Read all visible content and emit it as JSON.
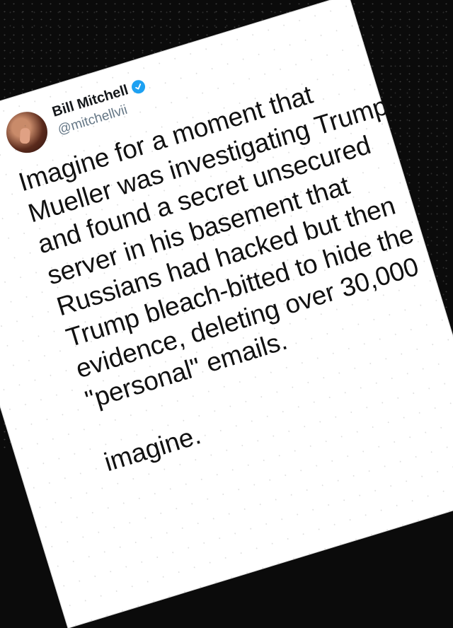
{
  "tweet": {
    "display_name": "Bill Mitchell",
    "handle": "@mitchellvii",
    "verified": true,
    "icons": {
      "avatar": "profile-photo",
      "badge": "verified-badge-icon"
    },
    "colors": {
      "verified": "#1da1f2",
      "handle": "#657786",
      "text": "#111111"
    },
    "lines": [
      "Imagine for a moment that",
      "Mueller was investigating Trump",
      "and found a secret unsecured",
      "server in his basement that",
      "Russians had hacked but then",
      "Trump bleach-bitted to hide the",
      "evidence, deleting over 30,000",
      "\"personal\" emails."
    ],
    "last_line": "imagine."
  }
}
